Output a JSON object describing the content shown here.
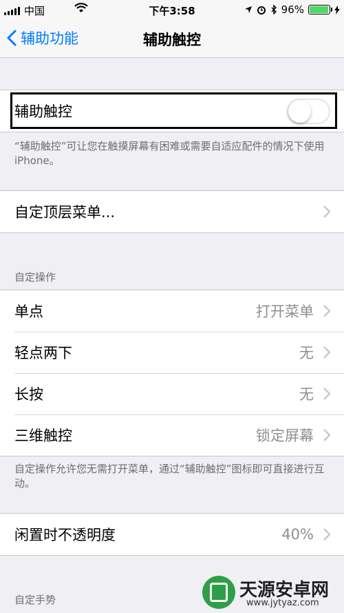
{
  "status_bar": {
    "carrier": "中国",
    "time": "下午3:58",
    "battery_percent": "96%",
    "battery_level": 0.96
  },
  "nav": {
    "back_label": "辅助功能",
    "title": "辅助触控"
  },
  "assistive_touch": {
    "label": "辅助触控",
    "enabled": false,
    "footer": "“辅助触控”可让您在触摸屏幕有困难或需要自适应配件的情况下使用 iPhone。"
  },
  "top_menu": {
    "label": "自定顶层菜单..."
  },
  "custom_actions": {
    "header": "自定操作",
    "rows": [
      {
        "label": "单点",
        "value": "打开菜单"
      },
      {
        "label": "轻点两下",
        "value": "无"
      },
      {
        "label": "长按",
        "value": "无"
      },
      {
        "label": "三维触控",
        "value": "锁定屏幕"
      }
    ],
    "footer": "自定操作允许您无需打开菜单，通过“辅助触控”图标即可直接进行互动。"
  },
  "idle_opacity": {
    "label": "闲置时不透明度",
    "value": "40%"
  },
  "custom_gestures": {
    "header": "自定手势"
  },
  "watermark": {
    "title": "天源安卓网",
    "url": "www.jytyaz.com"
  },
  "colors": {
    "accent": "#007aff",
    "background": "#efeff4",
    "secondary_text": "#8e8e93",
    "battery_fill": "#4cd964"
  }
}
